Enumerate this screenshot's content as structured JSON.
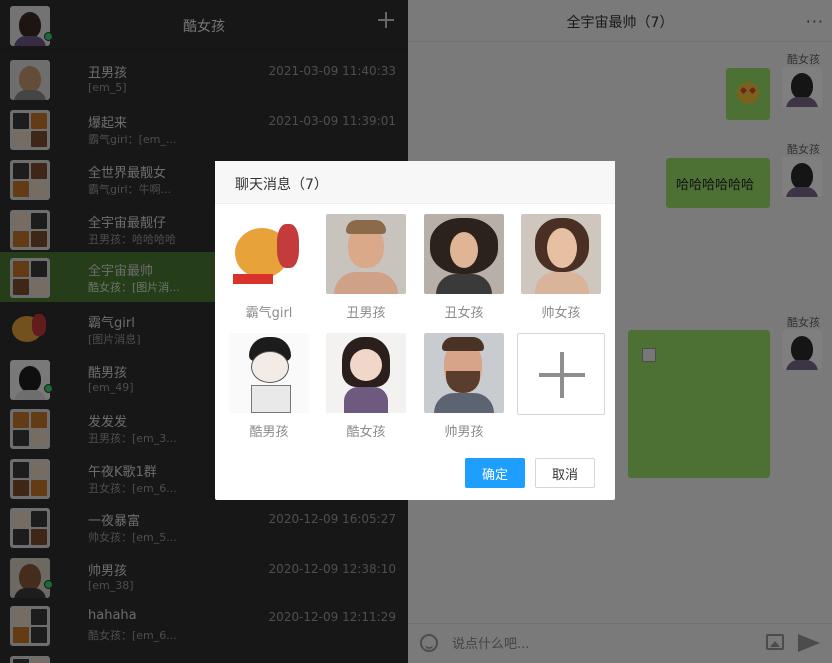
{
  "sidebar": {
    "title": "酷女孩",
    "conversations": [
      {
        "name": "丑男孩",
        "last": "[em_5]",
        "time": "2021-03-09 11:40:33"
      },
      {
        "name": "爆起来",
        "last": "霸气girl：[em_...",
        "time": "2021-03-09 11:39:01"
      },
      {
        "name": "全世界最靓女",
        "last": "霸气girl：牛啊...",
        "time": ""
      },
      {
        "name": "全宇宙最靓仔",
        "last": "丑男孩：哈哈哈哈",
        "time": ""
      },
      {
        "name": "全宇宙最帅",
        "last": "酷女孩：[图片消...",
        "time": ""
      },
      {
        "name": "霸气girl",
        "last": "[图片消息]",
        "time": ""
      },
      {
        "name": "酷男孩",
        "last": "[em_49]",
        "time": ""
      },
      {
        "name": "发发发",
        "last": "丑男孩：[em_3...",
        "time": ""
      },
      {
        "name": "午夜K歌1群",
        "last": "丑女孩：[em_6...",
        "time": ""
      },
      {
        "name": "一夜暴富",
        "last": "帅女孩：[em_5...",
        "time": "2020-12-09 16:05:27"
      },
      {
        "name": "帅男孩",
        "last": "[em_38]",
        "time": "2020-12-09 12:38:10"
      },
      {
        "name": "hahaha",
        "last": "酷女孩：[em_6...",
        "time": "2020-12-09 12:11:29"
      },
      {
        "name": "",
        "last": "",
        "time": ""
      }
    ]
  },
  "chat": {
    "title": "全宇宙最帅（7）",
    "more_label": "···",
    "messages": [
      {
        "sender": "酷女孩",
        "type": "emoji"
      },
      {
        "sender": "酷女孩",
        "text": "哈哈哈哈哈哈"
      },
      {
        "sender": "酷女孩",
        "type": "image"
      }
    ],
    "input_placeholder": "说点什么吧..."
  },
  "dialog": {
    "title": "聊天消息（7）",
    "members": [
      "霸气girl",
      "丑男孩",
      "丑女孩",
      "帅女孩",
      "酷男孩",
      "酷女孩",
      "帅男孩"
    ],
    "ok_label": "确定",
    "cancel_label": "取消"
  },
  "colors": {
    "accent_green": "#9be26b",
    "active_row": "#4a7a32",
    "primary_button": "#1e9fff"
  },
  "icons": [
    "plus-icon",
    "more-icon",
    "smile-icon",
    "image-icon",
    "send-icon",
    "add-member-icon"
  ]
}
